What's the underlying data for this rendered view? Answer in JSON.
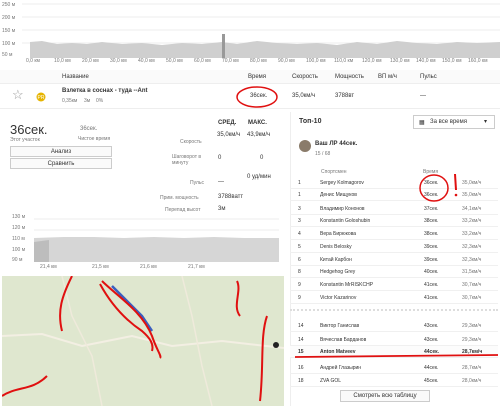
{
  "top_profile": {
    "y_labels": [
      "250 м",
      "200 м",
      "150 м",
      "100 м",
      "50 м"
    ],
    "x_labels": [
      "0,0 км",
      "10,0 км",
      "20,0 км",
      "30,0 км",
      "40,0 км",
      "50,0 км",
      "60,0 км",
      "70,0 км",
      "80,0 км",
      "90,0 км",
      "100,0 км",
      "110,0 км",
      "120,0 км",
      "130,0 км",
      "140,0 км",
      "150,0 км",
      "160,0 км",
      "170,0 км"
    ]
  },
  "segments_header": {
    "name": "Название",
    "time": "Время",
    "speed": "Скорость",
    "power": "Мощность",
    "vam": "ВП м/ч",
    "pulse": "Пульс"
  },
  "segment_row": {
    "name": "Взлетка в соснах - туда --Ant",
    "dist": "0,35км",
    "elev": "3м",
    "grade": "0%",
    "time": "36сек.",
    "speed": "35,0км/ч",
    "power": "3788вт",
    "pulse": "—"
  },
  "detail": {
    "time": "36сек.",
    "time_label": "Этот участок",
    "clock": "36сек.",
    "clock_label": "Чистое время",
    "analyze_btn": "Анализ",
    "compare_btn": "Сравнить",
    "col_avg": "СРЕД.",
    "col_max": "МАКС.",
    "speed_label": "Скорость",
    "speed_avg": "35,0км/ч",
    "speed_max": "43,9км/ч",
    "cadence_label": "Шаговорот в минуту",
    "cadence_avg": "0",
    "cadence_max": "0",
    "hr_label": "Пульс",
    "hr_avg": "—",
    "hr_max": "0 уд/мин",
    "power_label": "Прим. мощность",
    "power_avg": "3788ватт",
    "elev_label": "Перепад высот",
    "elev_val": "3м"
  },
  "mini_profile": {
    "y_labels": [
      "130 м",
      "120 м",
      "110 м",
      "100 м",
      "90 м"
    ],
    "x_labels": [
      "21,4 км",
      "21,5 км",
      "21,6 км",
      "21,7 км"
    ]
  },
  "top10": {
    "title": "Топ-10",
    "filter": "За все время",
    "pr_label": "Ваш ЛР 44сек.",
    "pr_rank": "15 / 68",
    "col_athlete": "Спортсмен",
    "col_time": "Время",
    "rows": [
      {
        "rank": "1",
        "name": "Sergey Kolmagorov",
        "time": "36сек.",
        "speed": "35,0км/ч"
      },
      {
        "rank": "1",
        "name": "Денис Мищуков",
        "time": "36сек.",
        "speed": "35,0км/ч"
      },
      {
        "rank": "3",
        "name": "Владимир Кононов",
        "time": "37сек.",
        "speed": "34,1км/ч"
      },
      {
        "rank": "3",
        "name": "Konstantin Goloshubin",
        "time": "38сек.",
        "speed": "33,2км/ч"
      },
      {
        "rank": "4",
        "name": "Вера Бирюкова",
        "time": "38сек.",
        "speed": "33,2км/ч"
      },
      {
        "rank": "5",
        "name": "Denis Belosky",
        "time": "39сек.",
        "speed": "32,3км/ч"
      },
      {
        "rank": "6",
        "name": "Китай Карбон",
        "time": "39сек.",
        "speed": "32,3км/ч"
      },
      {
        "rank": "8",
        "name": "Hedgehog Grey",
        "time": "40сек.",
        "speed": "31,5км/ч"
      },
      {
        "rank": "9",
        "name": "Konstantin MrRISKCHP",
        "time": "41сек.",
        "speed": "30,7км/ч"
      },
      {
        "rank": "9",
        "name": "Victor Kazarinov",
        "time": "41сек.",
        "speed": "30,7км/ч"
      }
    ],
    "rows_after": [
      {
        "rank": "14",
        "name": "Виктор Ганислав",
        "time": "43сек.",
        "speed": "29,3км/ч"
      },
      {
        "rank": "14",
        "name": "Вячеслав Барданов",
        "time": "43сек.",
        "speed": "29,3км/ч"
      },
      {
        "rank": "15",
        "name": "Anton Matveev",
        "time": "44сек.",
        "speed": "28,7км/ч"
      },
      {
        "rank": "16",
        "name": "Андрей Глазырин",
        "time": "44сек.",
        "speed": "28,7км/ч"
      },
      {
        "rank": "18",
        "name": "ZVA GOL",
        "time": "45сек.",
        "speed": "28,0км/ч"
      }
    ],
    "table_btn": "Смотреть всю таблицу"
  },
  "colors": {
    "accent": "#fc4c02",
    "annotation": "#e01010",
    "grid": "#eeeeee",
    "profile": "#cccccc"
  }
}
